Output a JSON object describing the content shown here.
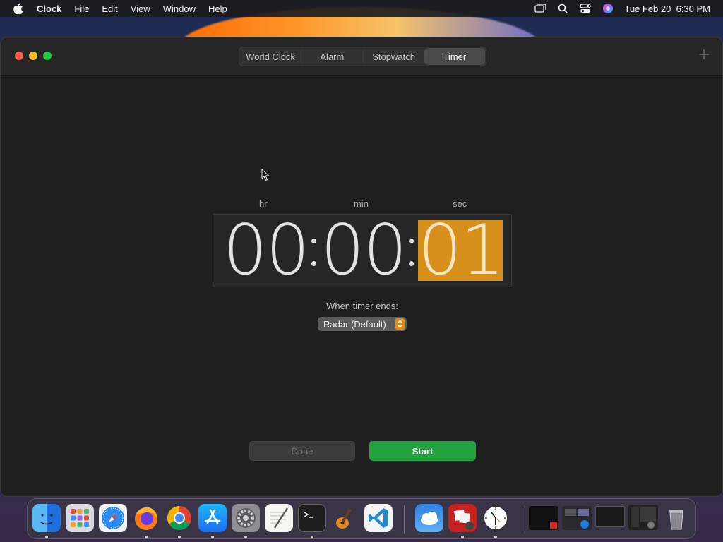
{
  "menubar": {
    "app_name": "Clock",
    "items": [
      "File",
      "Edit",
      "View",
      "Window",
      "Help"
    ],
    "datetime": "Tue Feb 20  6:30 PM"
  },
  "window": {
    "tabs": [
      {
        "label": "World Clock"
      },
      {
        "label": "Alarm"
      },
      {
        "label": "Stopwatch"
      },
      {
        "label": "Timer"
      }
    ],
    "active_tab": "Timer"
  },
  "timer": {
    "labels": {
      "hr": "hr",
      "min": "min",
      "sec": "sec"
    },
    "hours": "00",
    "minutes": "00",
    "seconds": "01",
    "selected_field": "sec",
    "ends_label": "When timer ends:",
    "sound": "Radar (Default)",
    "done_label": "Done",
    "start_label": "Start"
  },
  "colors": {
    "accent": "#d8901c",
    "start_green": "#22a33f"
  },
  "dock": {
    "apps": [
      "finder-icon",
      "launchpad-icon",
      "safari-icon",
      "firefox-icon",
      "chrome-icon",
      "app-store-icon",
      "system-settings-icon",
      "textedit-icon",
      "terminal-icon",
      "garageband-icon",
      "vscode-icon",
      "weather-icon",
      "photo-booth-icon",
      "clock-icon",
      "window-thumb-icon",
      "window-thumb-icon",
      "window-thumb-icon",
      "window-thumb-icon",
      "trash-icon"
    ]
  }
}
